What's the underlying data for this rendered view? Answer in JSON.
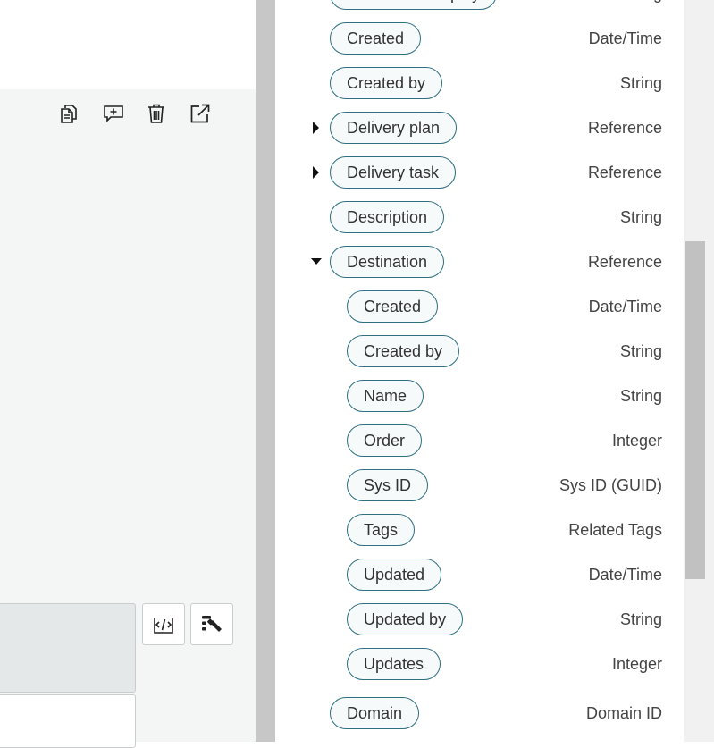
{
  "fields": [
    {
      "label": "Correlation display",
      "type": "String",
      "indent": 0,
      "caret": null
    },
    {
      "label": "Created",
      "type": "Date/Time",
      "indent": 0,
      "caret": null
    },
    {
      "label": "Created by",
      "type": "String",
      "indent": 0,
      "caret": null
    },
    {
      "label": "Delivery plan",
      "type": "Reference",
      "indent": 0,
      "caret": "collapsed"
    },
    {
      "label": "Delivery task",
      "type": "Reference",
      "indent": 0,
      "caret": "collapsed"
    },
    {
      "label": "Description",
      "type": "String",
      "indent": 0,
      "caret": null
    },
    {
      "label": "Destination",
      "type": "Reference",
      "indent": 0,
      "caret": "expanded"
    },
    {
      "label": "Created",
      "type": "Date/Time",
      "indent": 1,
      "caret": null
    },
    {
      "label": "Created by",
      "type": "String",
      "indent": 1,
      "caret": null
    },
    {
      "label": "Name",
      "type": "String",
      "indent": 1,
      "caret": null
    },
    {
      "label": "Order",
      "type": "Integer",
      "indent": 1,
      "caret": null
    },
    {
      "label": "Sys ID",
      "type": "Sys ID (GUID)",
      "indent": 1,
      "caret": null
    },
    {
      "label": "Tags",
      "type": "Related Tags",
      "indent": 1,
      "caret": null
    },
    {
      "label": "Updated",
      "type": "Date/Time",
      "indent": 1,
      "caret": null
    },
    {
      "label": "Updated by",
      "type": "String",
      "indent": 1,
      "caret": null
    },
    {
      "label": "Updates",
      "type": "Integer",
      "indent": 1,
      "caret": null
    },
    {
      "label": "Domain",
      "type": "Domain ID",
      "indent": 0,
      "caret": null
    }
  ],
  "toolbar": {
    "icons": [
      "copy-icon",
      "add-comment-icon",
      "trash-icon",
      "open-external-icon"
    ]
  },
  "side_buttons": [
    "script-editor-icon",
    "condition-builder-icon"
  ],
  "colors": {
    "pill_border": "#2e6f80",
    "pill_bg": "#f6fafb",
    "divider": "#c7c7c7",
    "left_bg": "#f4f6f6"
  }
}
